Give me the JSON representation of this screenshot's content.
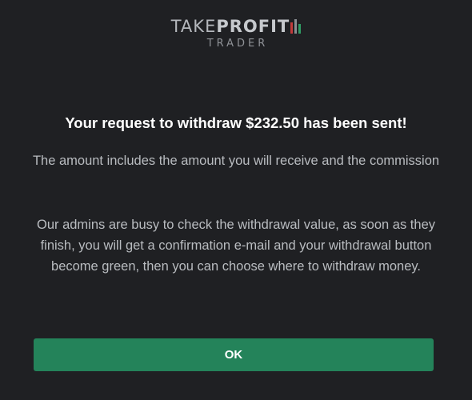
{
  "logo": {
    "primary_light": "TAKE",
    "primary_bold": "PROFIT",
    "secondary": "TRADER",
    "bar_colors": [
      "#c23b3b",
      "#8a8d91",
      "#2f9a63"
    ]
  },
  "dialog": {
    "title": "Your request to withdraw $232.50 has been sent!",
    "paragraph_1": "The amount includes the amount you will receive and the commission",
    "paragraph_2": "Our admins are busy to check the withdrawal value, as soon as they finish, you will get a confirmation e-mail and your withdrawal button become green, then you can choose where to withdraw money.",
    "ok_label": "OK"
  },
  "colors": {
    "background": "#1f2023",
    "accent_green": "#24835a",
    "title_text": "#ffffff",
    "body_text": "#b9bcc0"
  }
}
